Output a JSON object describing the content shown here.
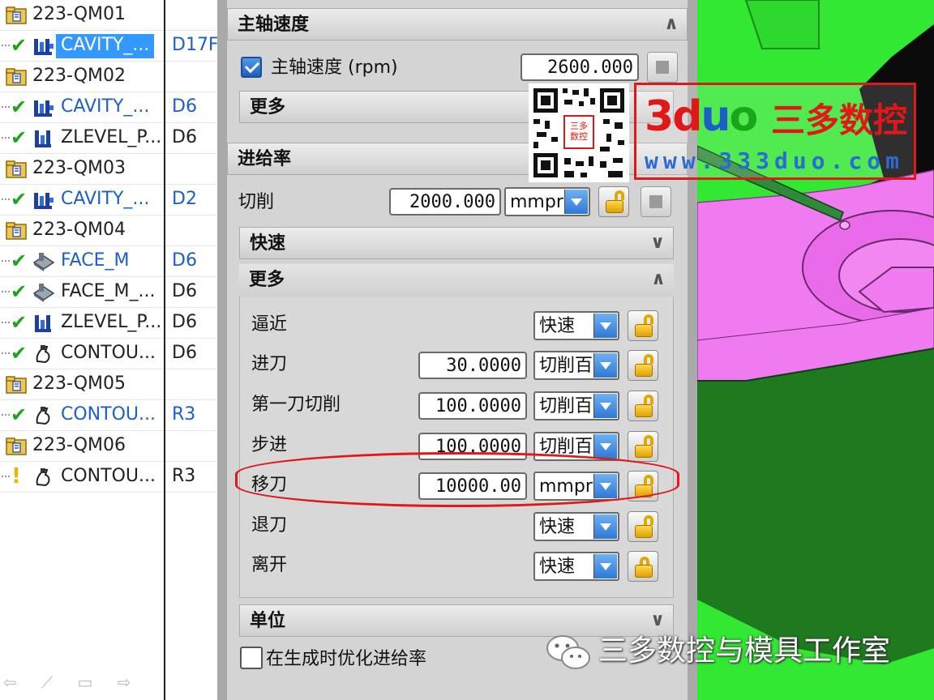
{
  "navigator": {
    "rows": [
      {
        "type": "program",
        "name": "223-QM01",
        "tool": ""
      },
      {
        "type": "op",
        "status": "ok",
        "icon": "cavity-mill-icon",
        "name": "CAVITY_...",
        "tool": "D17F",
        "selected": true,
        "blue": true
      },
      {
        "type": "program",
        "name": "223-QM02",
        "tool": ""
      },
      {
        "type": "op",
        "status": "ok",
        "icon": "cavity-mill-icon",
        "name": "CAVITY_...",
        "tool": "D6",
        "blue": true
      },
      {
        "type": "op",
        "status": "ok",
        "icon": "zlevel-mill-icon",
        "name": "ZLEVEL_P...",
        "tool": "D6",
        "blue": false
      },
      {
        "type": "program",
        "name": "223-QM03",
        "tool": ""
      },
      {
        "type": "op",
        "status": "ok",
        "icon": "cavity-mill-icon",
        "name": "CAVITY_...",
        "tool": "D2",
        "blue": true
      },
      {
        "type": "program",
        "name": "223-QM04",
        "tool": ""
      },
      {
        "type": "op",
        "status": "ok",
        "icon": "face-mill-icon",
        "name": "FACE_M",
        "tool": "D6",
        "blue": true
      },
      {
        "type": "op",
        "status": "ok",
        "icon": "face-mill-icon",
        "name": "FACE_M_...",
        "tool": "D6",
        "blue": false
      },
      {
        "type": "op",
        "status": "ok",
        "icon": "zlevel-mill-icon",
        "name": "ZLEVEL_P...",
        "tool": "D6",
        "blue": false
      },
      {
        "type": "op",
        "status": "ok",
        "icon": "contour-mill-icon",
        "name": "CONTOU...",
        "tool": "D6",
        "blue": false
      },
      {
        "type": "program",
        "name": "223-QM05",
        "tool": ""
      },
      {
        "type": "op",
        "status": "ok",
        "icon": "contour-mill-icon",
        "name": "CONTOU...",
        "tool": "R3",
        "blue": true
      },
      {
        "type": "program",
        "name": "223-QM06",
        "tool": ""
      },
      {
        "type": "op",
        "status": "warn",
        "icon": "contour-mill-icon",
        "name": "CONTOU...",
        "tool": "R3",
        "blue": false
      }
    ],
    "toolbar_icons": "⇦ ⟋ ▭ ⇨"
  },
  "spindle": {
    "title": "主轴速度",
    "checkbox_label": "主轴速度 (rpm)",
    "value": "2600.000",
    "more": "更多"
  },
  "feed": {
    "title": "进给率",
    "cut_label": "切削",
    "cut_value": "2000.000",
    "cut_unit": "mmpr",
    "rapid_title": "快速",
    "more_title": "更多",
    "rows": [
      {
        "label": "逼近",
        "value": "",
        "unit": "快速"
      },
      {
        "label": "进刀",
        "value": "30.0000",
        "unit": "切削百"
      },
      {
        "label": "第一刀切削",
        "value": "100.0000",
        "unit": "切削百"
      },
      {
        "label": "步进",
        "value": "100.0000",
        "unit": "切削百"
      },
      {
        "label": "移刀",
        "value": "10000.00",
        "unit": "mmpr"
      },
      {
        "label": "退刀",
        "value": "",
        "unit": "快速"
      },
      {
        "label": "离开",
        "value": "",
        "unit": "快速"
      }
    ],
    "units_title": "单位",
    "optimize_label": "在生成时优化进给率"
  },
  "overlay": {
    "qr_caption": "三多\n数控",
    "brand": "3duo",
    "brand_cn": "三多数控",
    "url": "www.333duo.com",
    "watermark": "三多数控与模具工作室"
  },
  "colors": {
    "accent_blue": "#3399ff",
    "highlight_red": "#e01818",
    "model_green": "#33e833",
    "model_dark_green": "#1f7a1f",
    "model_magenta": "#f07af0"
  }
}
